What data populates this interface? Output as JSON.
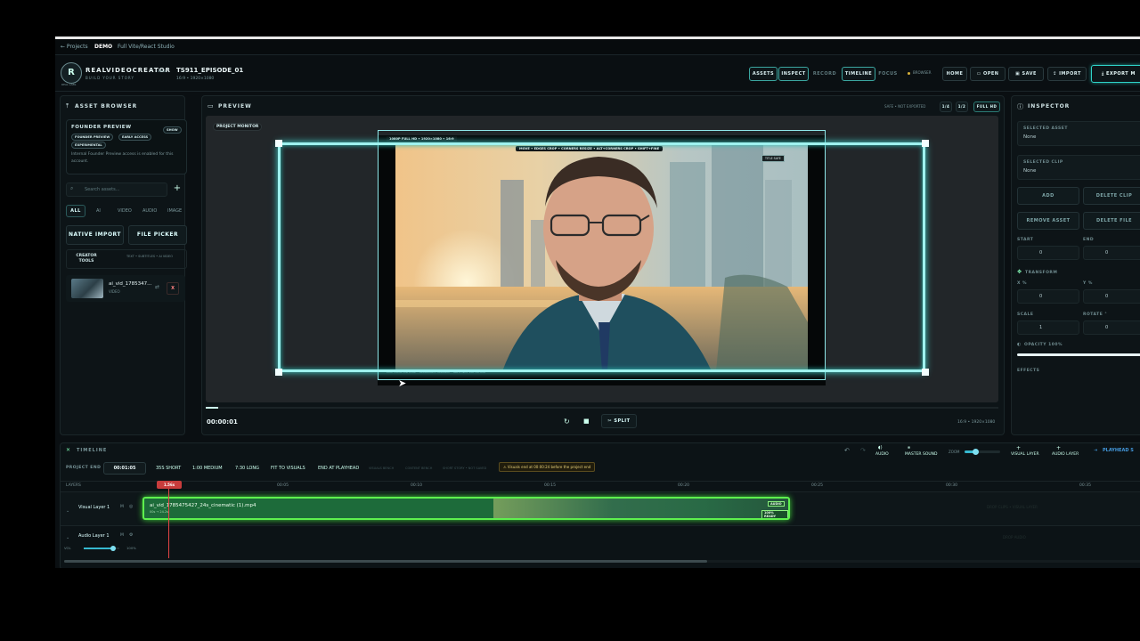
{
  "topbar": {
    "back_label": "← Projects",
    "badge": "DEMO",
    "studio": "Full Vite/React Studio"
  },
  "header": {
    "logo_text": "R",
    "logo_caption": "REAL LABS",
    "brand": "REALVIDEOCREATOR",
    "brand_tag": "Beta",
    "brand_sub": "BUILD YOUR STORY",
    "project_title": "TS911_EPISODE_01",
    "project_sub": "16:9 • 1920×1080",
    "tabs": [
      {
        "label": "ASSETS"
      },
      {
        "label": "INSPECT"
      },
      {
        "label": "RECORD"
      },
      {
        "label": "TIMELINE"
      },
      {
        "label": "FOCUS"
      }
    ],
    "browser_status": "BROWSER",
    "home": "HOME",
    "open": "OPEN",
    "save": "SAVE",
    "import": "IMPORT",
    "export": "EXPORT M"
  },
  "asset_browser": {
    "title": "ASSET BROWSER",
    "founder_title": "FOUNDER PREVIEW",
    "show": "SHOW",
    "chips": [
      "FOUNDER PREVIEW",
      "EARLY ACCESS",
      "EXPERIMENTAL"
    ],
    "founder_note": "Internal Founder Preview access is enabled for this account.",
    "search_placeholder": "Search assets...",
    "filters": [
      "ALL",
      "AI",
      "VIDEO",
      "AUDIO",
      "IMAGE"
    ],
    "native_import": "NATIVE IMPORT",
    "file_picker": "FILE PICKER",
    "creator_tools": "CREATOR TOOLS",
    "creator_tools_sub": "TEXT • SUBTITLES • AI VIDEO",
    "asset_name": "ai_vid_1785347...",
    "asset_type": "VIDEO",
    "asset_remove": "X"
  },
  "preview": {
    "title": "PREVIEW",
    "status": "SAFE • NOT EXPORTED",
    "quality_options": [
      "1/4",
      "1/2",
      "FULL HD"
    ],
    "monitor_label": "PROJECT MONITOR",
    "frame_label": "1080P FULL HD • 1920×1080 • 16:9",
    "hint": "MOVE • EDGES CROP • CORNERS RESIZE • ALT+CORNERS CROP • SHIFT+FINE",
    "title_safe": "TITLE SAFE",
    "bottom_note": "LIVE COMPOSITION • REALVIDEO CANVAS • SAFE NOT EXPORTED",
    "timecode": "00:00:01",
    "split": "SPLIT",
    "format": "16:9 • 1920×1080"
  },
  "inspector": {
    "title": "INSPECTOR",
    "selected_asset_label": "SELECTED ASSET",
    "selected_asset_value": "None",
    "selected_clip_label": "SELECTED CLIP",
    "selected_clip_value": "None",
    "add": "ADD",
    "delete_clip": "DELETE CLIP",
    "remove_asset": "REMOVE ASSET",
    "delete_file": "DELETE FILE",
    "start_label": "START",
    "start_value": "0",
    "end_label": "END",
    "end_value": "0",
    "transform": "TRANSFORM",
    "x_label": "X %",
    "x_value": "0",
    "y_label": "Y %",
    "y_value": "0",
    "scale_label": "SCALE",
    "scale_value": "1",
    "rotate_label": "ROTATE °",
    "rotate_value": "0",
    "opacity_label": "OPACITY 100%",
    "opacity_value": 1.0,
    "effects": "EFFECTS"
  },
  "timeline": {
    "title": "TIMELINE",
    "audio": "AUDIO",
    "master_sound": "MASTER SOUND",
    "zoom": "ZOOM",
    "zoom_level": 0.3,
    "visual_layer": "VISUAL LAYER",
    "audio_layer": "AUDIO LAYER",
    "playhead": "PLAYHEAD S",
    "project_end_label": "PROJECT END",
    "project_end_value": "00:01:05",
    "presets": [
      "35S SHORT",
      "1:00 MEDIUM",
      "7:30 LONG",
      "FIT TO VISUALS",
      "END AT PLAYHEAD"
    ],
    "muted_notes": [
      "VISUALS BENCH",
      "CONTENT BENCH",
      "SHORT STORY • NOT SAVED"
    ],
    "warning": "⚠ Visuals end at 00:00:24 before the project end",
    "layers_label": "LAYERS",
    "playhead_time": "1.56s",
    "ruler_marks": [
      "00:05",
      "00:10",
      "00:15",
      "00:20",
      "00:25",
      "00:30",
      "00:35"
    ],
    "track_visual": "Visual Layer 1",
    "track_audio": "Audio Layer 1",
    "track_m": "M",
    "vol_label": "VOL",
    "vol_value": "100%",
    "clip_name": "ai_vid_1785475427_24s_cinematic (1).mp4",
    "clip_sub": "00s → 24.2s",
    "clip_audio_badge": "AUDIO",
    "clip_ready_badge": "100% READY",
    "drop_hint": "DROP CLIPS • VISUAL LAYER",
    "drop_hint_audio": "DROP AUDIO"
  }
}
